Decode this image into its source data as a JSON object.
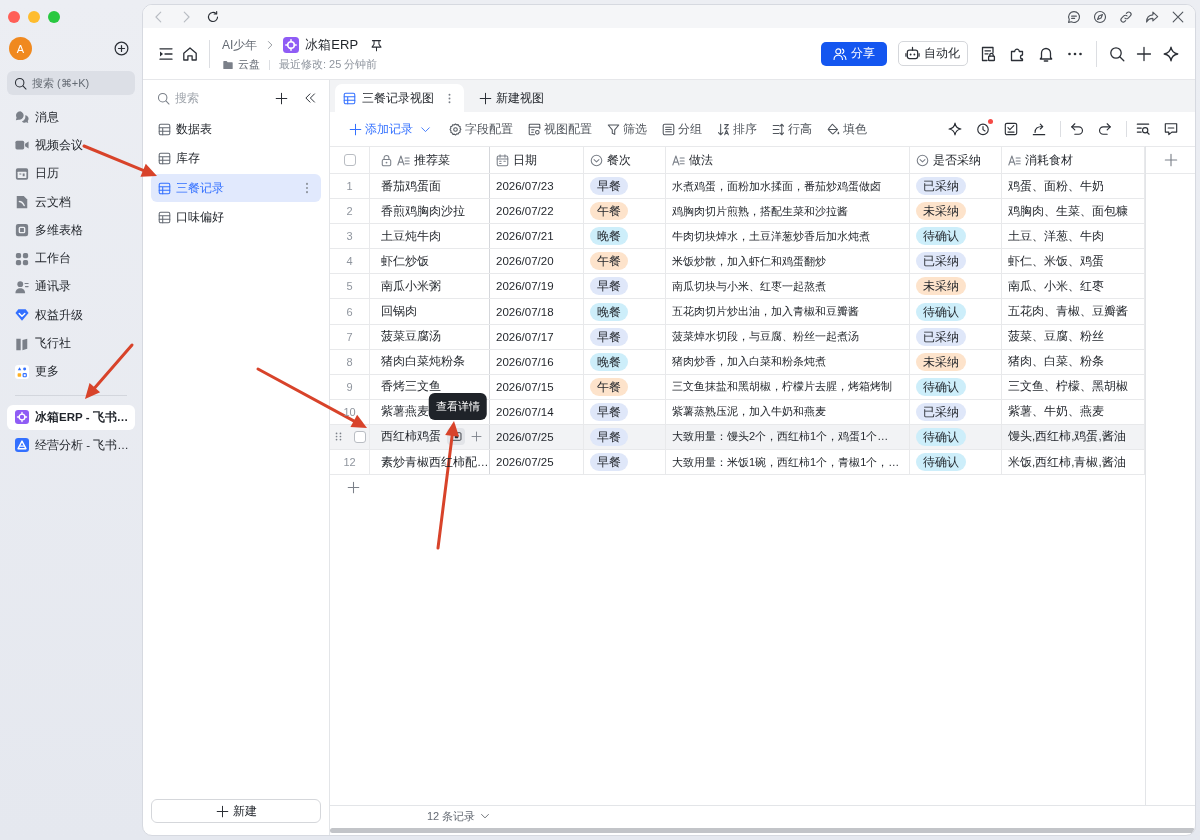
{
  "app_sidebar": {
    "avatar": "A",
    "search": {
      "placeholder": "搜索 (⌘+K)"
    },
    "items": [
      {
        "label": "消息",
        "selected": false
      },
      {
        "label": "视频会议",
        "selected": false
      },
      {
        "label": "日历",
        "selected": false
      },
      {
        "label": "云文档",
        "selected": false
      },
      {
        "label": "多维表格",
        "selected": false
      },
      {
        "label": "工作台",
        "selected": false
      },
      {
        "label": "通讯录",
        "selected": false
      },
      {
        "label": "权益升级",
        "selected": false
      },
      {
        "label": "飞行社",
        "selected": false
      },
      {
        "label": "更多",
        "selected": false
      }
    ],
    "open_docs": [
      {
        "label": "冰箱ERP - 飞书…",
        "selected": true
      },
      {
        "label": "经营分析 - 飞书…",
        "selected": false
      }
    ]
  },
  "browser_bar": {
    "back": {
      "disabled": true
    },
    "forward": {
      "disabled": true
    }
  },
  "header": {
    "breadcrumb": "AI少年",
    "title": "冰箱ERP",
    "location": "云盘",
    "modified": "最近修改: 25 分钟前",
    "share_button": "分享",
    "automation_button": "自动化"
  },
  "side_panel": {
    "search": {
      "placeholder": "搜索"
    },
    "items": [
      {
        "label": "数据表",
        "selected": false
      },
      {
        "label": "库存",
        "selected": false
      },
      {
        "label": "三餐记录",
        "selected": true
      },
      {
        "label": "口味偏好",
        "selected": false
      }
    ],
    "new_button": "新建"
  },
  "view_tabs": {
    "tabs": [
      {
        "label": "三餐记录视图",
        "selected": true
      }
    ],
    "new_view": "新建视图"
  },
  "toolbar": {
    "add_record": "添加记录",
    "tools": [
      "字段配置",
      "视图配置",
      "筛选",
      "分组",
      "排序",
      "行高",
      "填色"
    ],
    "history_notification": true
  },
  "table": {
    "select_all": false,
    "columns": [
      {
        "label": "推荐菜",
        "kind": "text",
        "locked": true
      },
      {
        "label": "日期",
        "kind": "date",
        "locked": false
      },
      {
        "label": "餐次",
        "kind": "select",
        "locked": false
      },
      {
        "label": "做法",
        "kind": "text",
        "locked": false
      },
      {
        "label": "是否采纳",
        "kind": "select",
        "locked": false
      },
      {
        "label": "消耗食材",
        "kind": "text",
        "locked": false
      }
    ],
    "rows": [
      {
        "number": "1",
        "dish": "番茄鸡蛋面",
        "date": "2026/07/23",
        "meal": {
          "text": "早餐",
          "color": "#dfe7f9"
        },
        "method": "水煮鸡蛋，面粉加水揉面，番茄炒鸡蛋做卤",
        "status": {
          "text": "已采纳",
          "color": "#dfe7f9"
        },
        "ingredients": "鸡蛋、面粉、牛奶",
        "hovered": false,
        "selected": false
      },
      {
        "number": "2",
        "dish": "香煎鸡胸肉沙拉",
        "date": "2026/07/22",
        "meal": {
          "text": "午餐",
          "color": "#fde3cb"
        },
        "method": "鸡胸肉切片煎熟，搭配生菜和沙拉酱",
        "status": {
          "text": "未采纳",
          "color": "#fde3cb"
        },
        "ingredients": "鸡胸肉、生菜、面包糠",
        "hovered": false,
        "selected": false
      },
      {
        "number": "3",
        "dish": "土豆炖牛肉",
        "date": "2026/07/21",
        "meal": {
          "text": "晚餐",
          "color": "#cdeefa"
        },
        "method": "牛肉切块焯水，土豆洋葱炒香后加水炖煮",
        "status": {
          "text": "待确认",
          "color": "#cdeefa"
        },
        "ingredients": "土豆、洋葱、牛肉",
        "hovered": false,
        "selected": false
      },
      {
        "number": "4",
        "dish": "虾仁炒饭",
        "date": "2026/07/20",
        "meal": {
          "text": "午餐",
          "color": "#fde3cb"
        },
        "method": "米饭炒散，加入虾仁和鸡蛋翻炒",
        "status": {
          "text": "已采纳",
          "color": "#dfe7f9"
        },
        "ingredients": "虾仁、米饭、鸡蛋",
        "hovered": false,
        "selected": false
      },
      {
        "number": "5",
        "dish": "南瓜小米粥",
        "date": "2026/07/19",
        "meal": {
          "text": "早餐",
          "color": "#dfe7f9"
        },
        "method": "南瓜切块与小米、红枣一起熬煮",
        "status": {
          "text": "未采纳",
          "color": "#fde3cb"
        },
        "ingredients": "南瓜、小米、红枣",
        "hovered": false,
        "selected": false
      },
      {
        "number": "6",
        "dish": "回锅肉",
        "date": "2026/07/18",
        "meal": {
          "text": "晚餐",
          "color": "#cdeefa"
        },
        "method": "五花肉切片炒出油，加入青椒和豆瓣酱",
        "status": {
          "text": "待确认",
          "color": "#cdeefa"
        },
        "ingredients": "五花肉、青椒、豆瓣酱",
        "hovered": false,
        "selected": false
      },
      {
        "number": "7",
        "dish": "菠菜豆腐汤",
        "date": "2026/07/17",
        "meal": {
          "text": "早餐",
          "color": "#dfe7f9"
        },
        "method": "菠菜焯水切段，与豆腐、粉丝一起煮汤",
        "status": {
          "text": "已采纳",
          "color": "#dfe7f9"
        },
        "ingredients": "菠菜、豆腐、粉丝",
        "hovered": false,
        "selected": false
      },
      {
        "number": "8",
        "dish": "猪肉白菜炖粉条",
        "date": "2026/07/16",
        "meal": {
          "text": "晚餐",
          "color": "#cdeefa"
        },
        "method": "猪肉炒香，加入白菜和粉条炖煮",
        "status": {
          "text": "未采纳",
          "color": "#fde3cb"
        },
        "ingredients": "猪肉、白菜、粉条",
        "hovered": false,
        "selected": false
      },
      {
        "number": "9",
        "dish": "香烤三文鱼",
        "date": "2026/07/15",
        "meal": {
          "text": "午餐",
          "color": "#fde3cb"
        },
        "method": "三文鱼抹盐和黑胡椒，柠檬片去腥，烤箱烤制",
        "status": {
          "text": "待确认",
          "color": "#cdeefa"
        },
        "ingredients": "三文鱼、柠檬、黑胡椒",
        "hovered": false,
        "selected": false
      },
      {
        "number": "10",
        "dish": "紫薯燕麦",
        "date": "2026/07/14",
        "meal": {
          "text": "早餐",
          "color": "#dfe7f9"
        },
        "method": "紫薯蒸熟压泥，加入牛奶和燕麦",
        "status": {
          "text": "已采纳",
          "color": "#dfe7f9"
        },
        "ingredients": "紫薯、牛奶、燕麦",
        "hovered": false,
        "selected": false
      },
      {
        "dish": "西红柿鸡蛋",
        "date": "2026/07/25",
        "meal": {
          "text": "早餐",
          "color": "#dfe7f9"
        },
        "method": "大致用量：馒头2个，西红柿1个，鸡蛋1个…",
        "status": {
          "text": "待确认",
          "color": "#cdeefa"
        },
        "ingredients": "馒头,西红柿,鸡蛋,酱油",
        "hovered": true,
        "selected": false
      },
      {
        "number": "12",
        "dish": "素炒青椒西红柿配…",
        "date": "2026/07/25",
        "meal": {
          "text": "早餐",
          "color": "#dfe7f9"
        },
        "method": "大致用量：米饭1碗，西红柿1个，青椒1个，…",
        "status": {
          "text": "待确认",
          "color": "#cdeefa"
        },
        "ingredients": "米饭,西红柿,青椒,酱油",
        "hovered": false,
        "selected": false
      }
    ],
    "tooltip": "查看详情"
  },
  "footer": {
    "record_count": "12 条记录"
  }
}
